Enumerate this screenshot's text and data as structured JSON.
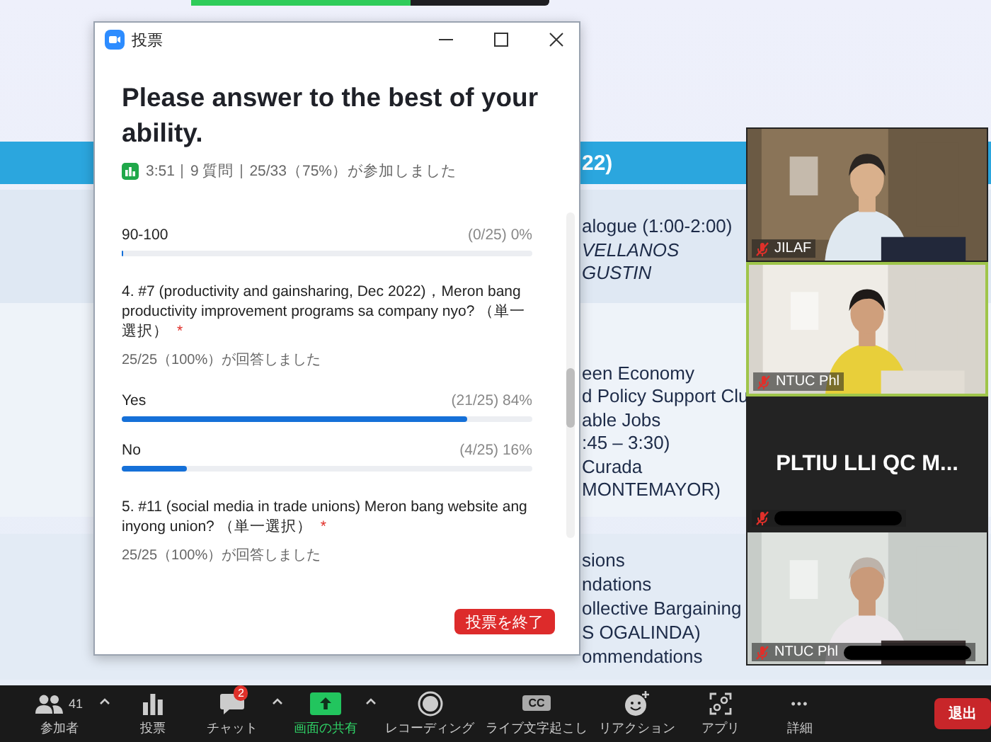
{
  "slide": {
    "header": "22)",
    "rows": [
      {
        "lines": [
          {
            "text": "alogue (1:00-2:00)",
            "italic": false
          },
          {
            "text": "VELLANOS",
            "italic": true
          },
          {
            "text": "GUSTIN",
            "italic": true
          }
        ]
      },
      {
        "lines": [
          {
            "text": "een Economy",
            "italic": false
          },
          {
            "text": "d Policy Support Clu",
            "italic": false
          },
          {
            "text": "able Jobs",
            "italic": false
          },
          {
            "text": ":45 – 3:30)",
            "italic": false
          },
          {
            "text": "Curada",
            "italic": false
          },
          {
            "text": "MONTEMAYOR)",
            "italic": false
          }
        ]
      },
      {
        "lines": [
          {
            "text": "sions",
            "italic": false
          },
          {
            "text": "ndations",
            "italic": false
          },
          {
            "text": "ollective Bargaining",
            "italic": false
          },
          {
            "text": "S OGALINDA)",
            "italic": false
          },
          {
            "text": "ommendations",
            "italic": false
          }
        ]
      }
    ]
  },
  "poll_window": {
    "title": "投票",
    "heading": "Please answer to the best of your ability.",
    "meta": {
      "time": "3:51",
      "questions": "9 質問",
      "participation": "25/33（75%）が参加しました"
    },
    "items": [
      {
        "kind": "option",
        "label": "90-100",
        "count": "(0/25) 0%",
        "level": 0
      },
      {
        "kind": "question",
        "text": "4. #7 (productivity and gainsharing, Dec 2022)，Meron bang productivity improvement programs sa company nyo? （単一選択）",
        "mark": "*",
        "answered": "25/25（100%）が回答しました"
      },
      {
        "kind": "option",
        "label": "Yes",
        "count": "(21/25) 84%",
        "level": 0.84
      },
      {
        "kind": "option",
        "label": "No",
        "count": "(4/25) 16%",
        "level": 0.16
      },
      {
        "kind": "question",
        "text": "5. #11 (social media in trade unions) Meron bang website ang inyong union? （単一選択）",
        "mark": "*",
        "answered": "25/25（100%）が回答しました"
      }
    ],
    "end_button": "投票を終了"
  },
  "video_tiles": [
    {
      "kind": "video",
      "name": "JILAF",
      "muted": true,
      "active_speaker": false,
      "redacted": false
    },
    {
      "kind": "video",
      "name": "NTUC Phl",
      "muted": true,
      "active_speaker": true,
      "redacted": false
    },
    {
      "kind": "name_card",
      "display_name": "PLTIU LLI QC M...",
      "muted": true,
      "active_speaker": false,
      "redacted": true
    },
    {
      "kind": "video",
      "name": "NTUC Phl",
      "muted": true,
      "active_speaker": false,
      "redacted": true
    }
  ],
  "toolbar": {
    "items": [
      {
        "kind": "participants",
        "label": "参加者",
        "count": "41",
        "caret": true,
        "highlighted": false
      },
      {
        "kind": "polls",
        "label": "投票",
        "caret": false,
        "highlighted": false
      },
      {
        "kind": "chat",
        "label": "チャット",
        "badge": "2",
        "caret": true,
        "highlighted": false
      },
      {
        "kind": "share",
        "label": "画面の共有",
        "caret": true,
        "highlighted": true
      },
      {
        "kind": "record",
        "label": "レコーディング",
        "caret": false,
        "highlighted": false
      },
      {
        "kind": "captions",
        "label": "ライブ文字起こし",
        "icon_text": "CC",
        "caret": false,
        "highlighted": false
      },
      {
        "kind": "reactions",
        "label": "リアクション",
        "caret": false,
        "highlighted": false
      },
      {
        "kind": "apps",
        "label": "アプリ",
        "caret": false,
        "highlighted": false
      },
      {
        "kind": "more",
        "label": "詳細",
        "icon_text": "•••",
        "caret": false,
        "highlighted": false
      }
    ],
    "leave_button": "退出"
  }
}
